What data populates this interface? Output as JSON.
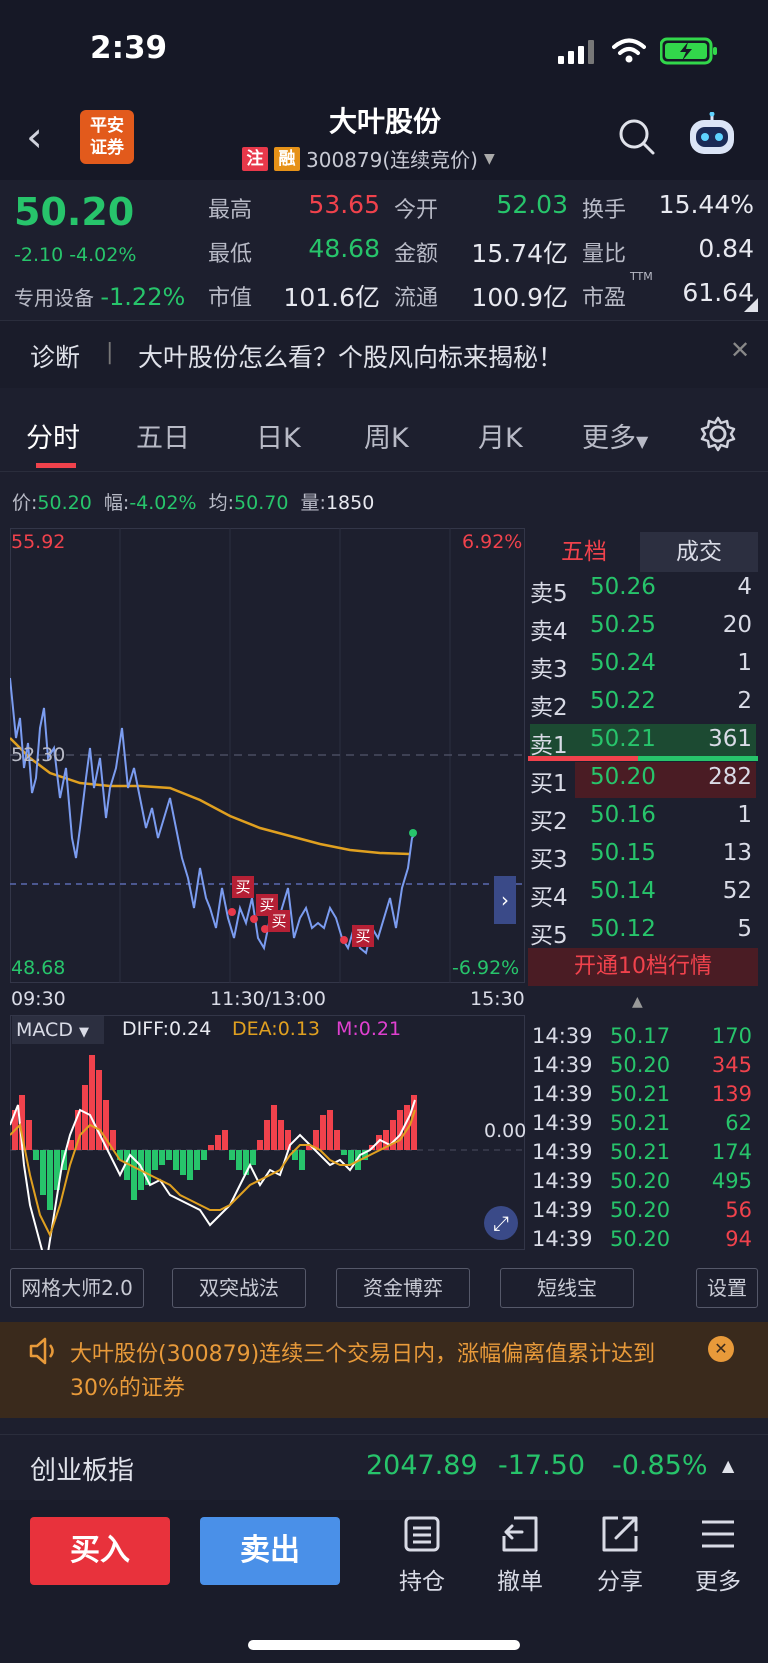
{
  "status": {
    "time": "2:39"
  },
  "header": {
    "logo_line1": "平安",
    "logo_line2": "证券",
    "title": "大叶股份",
    "tag1": "注",
    "tag2": "融",
    "code": "300879(连续竞价)"
  },
  "quote": {
    "price": "50.20",
    "change": "-2.10 -4.02%",
    "sector": "专用设备",
    "sector_change": "-1.22%",
    "high_label": "最高",
    "high": "53.65",
    "low_label": "最低",
    "low": "48.68",
    "mcap_label": "市值",
    "mcap": "101.6亿",
    "open_label": "今开",
    "open": "52.03",
    "amount_label": "金额",
    "amount": "15.74亿",
    "float_label": "流通",
    "float": "100.9亿",
    "turnover_label": "换手",
    "turnover": "15.44%",
    "ratio_label": "量比",
    "ratio": "0.84",
    "pe_label": "市盈",
    "pe_sup": "TTM",
    "pe": "61.64"
  },
  "diagnosis": {
    "label": "诊断",
    "sep": "|",
    "text": "大叶股份怎么看？个股风向标来揭秘！"
  },
  "tabs": [
    "分时",
    "五日",
    "日K",
    "周K",
    "月K",
    "更多"
  ],
  "info": {
    "price_label": "价:",
    "price": "50.20",
    "amp_label": "幅:",
    "amp": "-4.02%",
    "avg_label": "均:",
    "avg": "50.70",
    "vol_label": "量:",
    "vol": "1850"
  },
  "chart": {
    "top_price": "55.92",
    "top_pct": "6.92%",
    "mid_price": "52.30",
    "bottom_price": "48.68",
    "bottom_pct": "-6.92%",
    "t_start": "09:30",
    "t_mid": "11:30/13:00",
    "t_end": "15:30",
    "buy_mark": "买"
  },
  "macd": {
    "name": "MACD",
    "diff": "DIFF:0.24",
    "dea": "DEA:0.13",
    "m": "M:0.21",
    "zero": "0.00"
  },
  "orderbook": {
    "tab1": "五档",
    "tab2": "成交",
    "asks": [
      {
        "k": "卖5",
        "p": "50.26",
        "v": "4"
      },
      {
        "k": "卖4",
        "p": "50.25",
        "v": "20"
      },
      {
        "k": "卖3",
        "p": "50.24",
        "v": "1"
      },
      {
        "k": "卖2",
        "p": "50.22",
        "v": "2"
      },
      {
        "k": "卖1",
        "p": "50.21",
        "v": "361"
      }
    ],
    "bids": [
      {
        "k": "买1",
        "p": "50.20",
        "v": "282"
      },
      {
        "k": "买2",
        "p": "50.16",
        "v": "1"
      },
      {
        "k": "买3",
        "p": "50.15",
        "v": "13"
      },
      {
        "k": "买4",
        "p": "50.14",
        "v": "52"
      },
      {
        "k": "买5",
        "p": "50.12",
        "v": "5"
      }
    ],
    "upgrade": "开通10档行情"
  },
  "ticks": [
    {
      "t": "14:39",
      "p": "50.17",
      "v": "170",
      "c": "green"
    },
    {
      "t": "14:39",
      "p": "50.20",
      "v": "345",
      "c": "red"
    },
    {
      "t": "14:39",
      "p": "50.21",
      "v": "139",
      "c": "red"
    },
    {
      "t": "14:39",
      "p": "50.21",
      "v": "62",
      "c": "green"
    },
    {
      "t": "14:39",
      "p": "50.21",
      "v": "174",
      "c": "green"
    },
    {
      "t": "14:39",
      "p": "50.20",
      "v": "495",
      "c": "green"
    },
    {
      "t": "14:39",
      "p": "50.20",
      "v": "56",
      "c": "red"
    },
    {
      "t": "14:39",
      "p": "50.20",
      "v": "94",
      "c": "red"
    }
  ],
  "tools": [
    "网格大师2.0",
    "双突战法",
    "资金博弈",
    "短线宝",
    "设置"
  ],
  "notice": {
    "text": "大叶股份(300879)连续三个交易日内，涨幅偏离值累计达到30%的证券"
  },
  "index": {
    "name": "创业板指",
    "value": "2047.89",
    "change": "-17.50",
    "pct": "-0.85%"
  },
  "bottom": {
    "buy": "买入",
    "sell": "卖出",
    "nav": [
      "持仓",
      "撤单",
      "分享",
      "更多"
    ]
  },
  "colors": {
    "up": "#f0424c",
    "down": "#27c46b",
    "price_line": "#7b9cf0",
    "avg_line": "#e0a020"
  }
}
